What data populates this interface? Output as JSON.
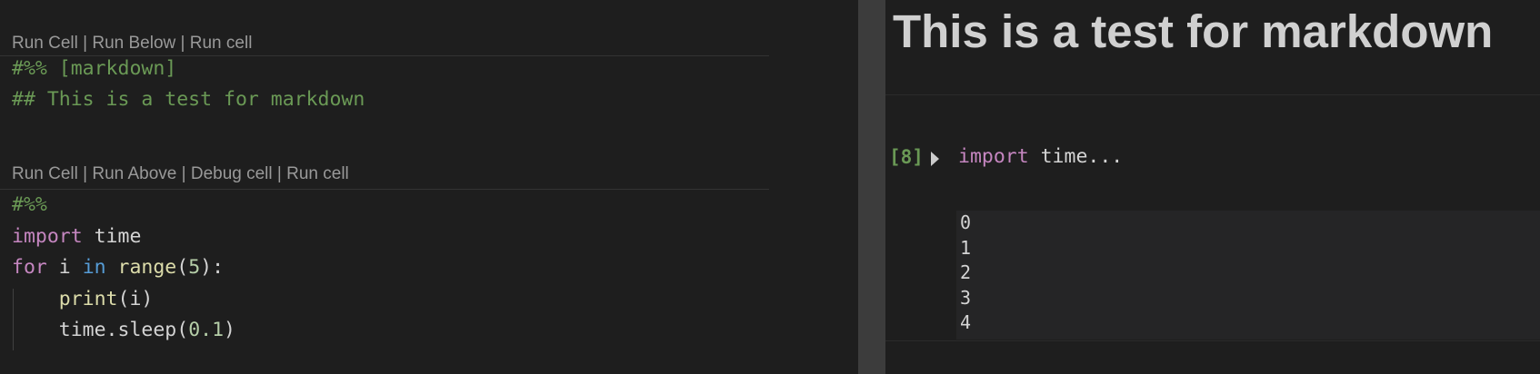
{
  "editor": {
    "cell1": {
      "codelens": [
        "Run Cell",
        "Run Below",
        "Run cell"
      ],
      "lines": [
        "#%% [markdown]",
        "## This is a test for markdown"
      ]
    },
    "cell2": {
      "codelens": [
        "Run Cell",
        "Run Above",
        "Debug cell",
        "Run cell"
      ],
      "marker": "#%%",
      "import_kw": "import",
      "import_mod": " time",
      "for_kw": "for",
      "for_var": " i ",
      "in_kw": "in",
      "range_fn": "range",
      "range_open": "(",
      "range_num": "5",
      "range_close": "):",
      "indent": "    ",
      "print_fn": "print",
      "print_args": "(i)",
      "sleep_obj": "time.",
      "sleep_fn": "sleep",
      "sleep_open": "(",
      "sleep_num": "0.1",
      "sleep_close": ")"
    },
    "lens_separator": " | "
  },
  "interactive_window": {
    "markdown_heading": "This is a test for markdown",
    "cell": {
      "execution_count": "[8]",
      "code_kw": "import",
      "code_rest": " time...",
      "output_lines": "0\n1\n2\n3\n4"
    }
  },
  "colors": {
    "background": "#1e1e1e",
    "comment": "#6a9955",
    "keyword": "#c586c0",
    "keyword_blue": "#569cd6",
    "function": "#dcdcaa",
    "number": "#b5cea8",
    "codelens": "#999999"
  },
  "icons": {
    "expand_toggle": "triangle-right"
  }
}
